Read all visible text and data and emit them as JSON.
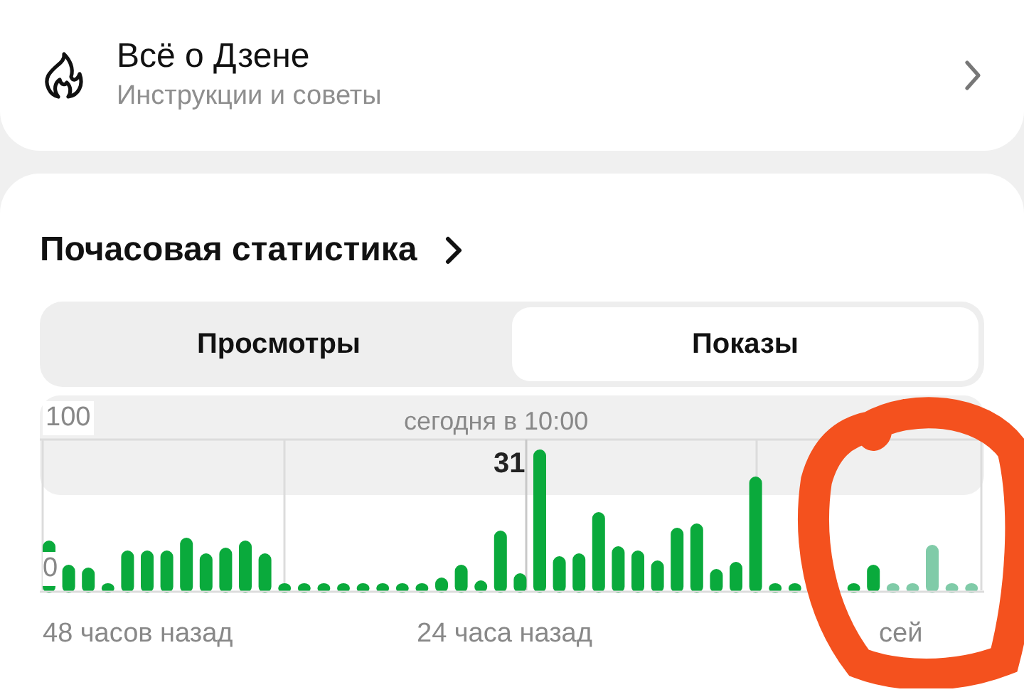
{
  "about_card": {
    "title": "Всё о Дзене",
    "subtitle": "Инструкции и советы"
  },
  "stats": {
    "title": "Почасовая статистика",
    "tabs": [
      {
        "label": "Просмотры",
        "selected": false
      },
      {
        "label": "Показы",
        "selected": true
      }
    ],
    "chart": {
      "y_max_label": "100",
      "y_min_label": "0",
      "tooltip": {
        "time": "сегодня в 10:00",
        "value": "31"
      },
      "x_labels": [
        "48 часов назад",
        "24 часа назад",
        "сей"
      ]
    }
  }
}
